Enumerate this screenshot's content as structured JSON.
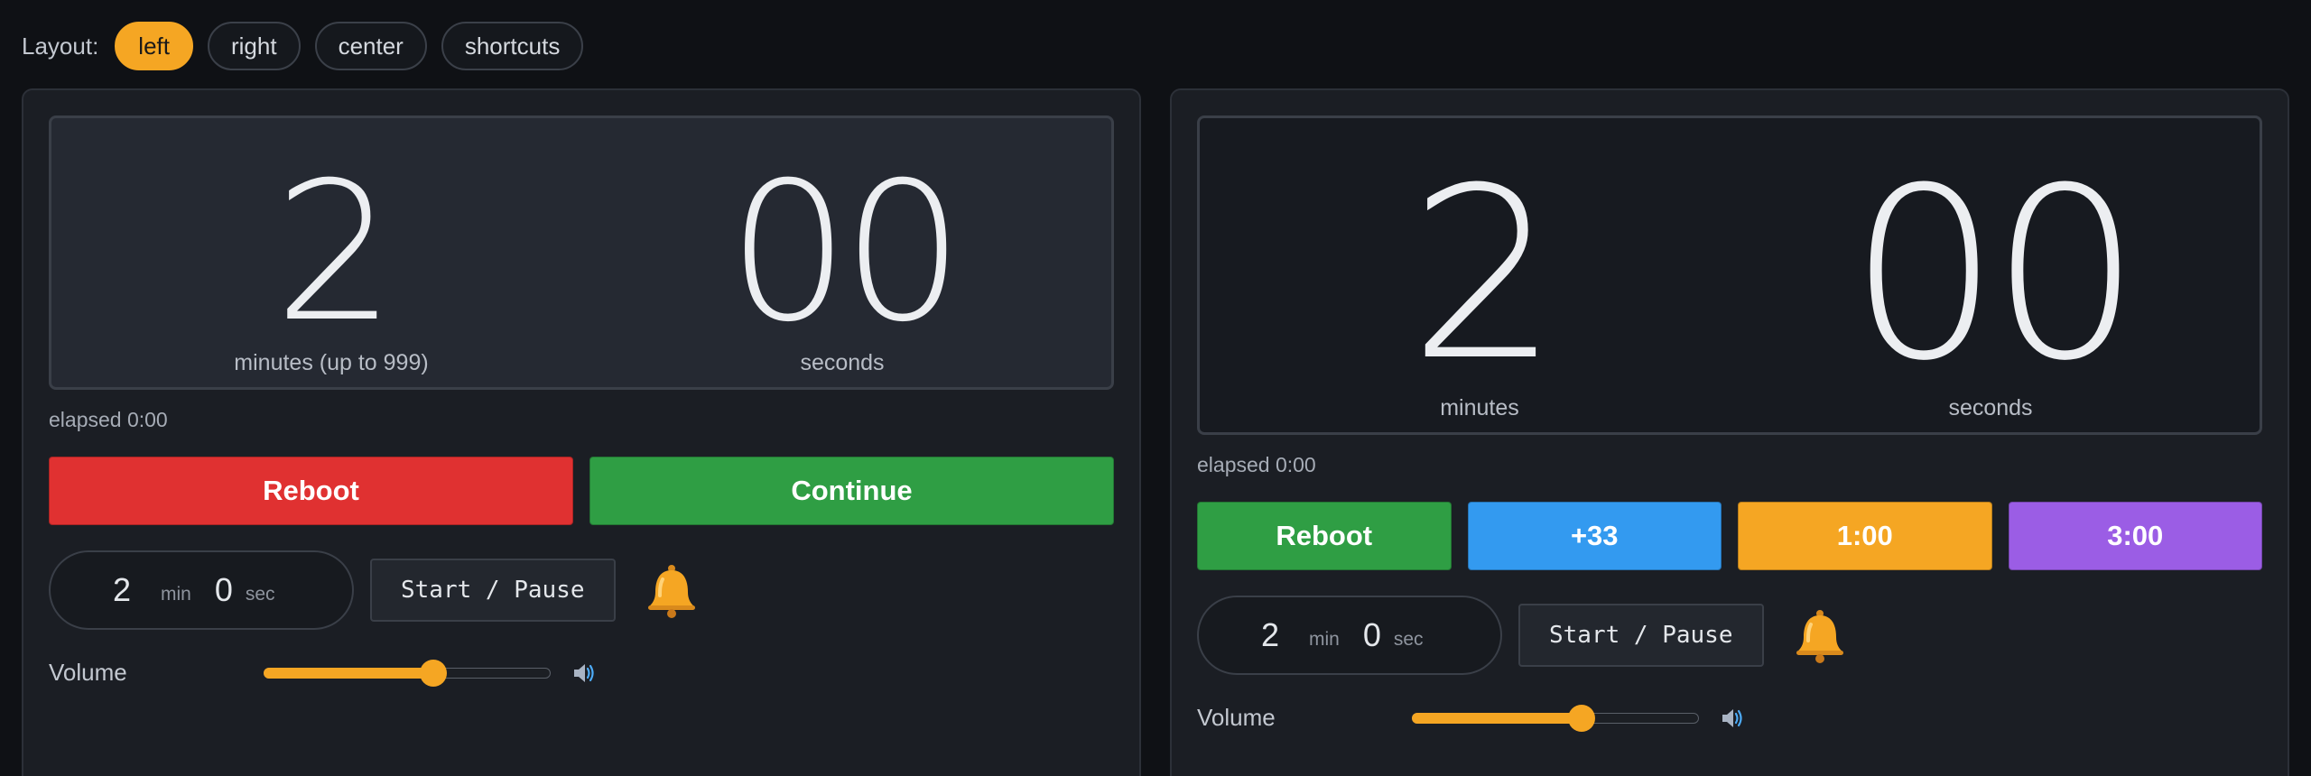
{
  "layout": {
    "label": "Layout:",
    "options": [
      {
        "label": "left",
        "active": true
      },
      {
        "label": "right",
        "active": false
      },
      {
        "label": "center",
        "active": false
      },
      {
        "label": "shortcuts",
        "active": false
      }
    ]
  },
  "colors": {
    "accent": "#f5a623",
    "red": "#e03131",
    "green": "#2f9e44",
    "blue": "#339af0",
    "orange": "#f5a623",
    "purple": "#9b5de5"
  },
  "left_panel": {
    "minutes": "2",
    "minutes_caption": "minutes (up to 999)",
    "seconds": "00",
    "seconds_caption": "seconds",
    "elapsed": "elapsed 0:00",
    "buttons": [
      {
        "label": "Reboot",
        "color": "#e03131"
      },
      {
        "label": "Continue",
        "color": "#2f9e44"
      }
    ],
    "input": {
      "minutes": "2",
      "min_unit": "min",
      "seconds": "0",
      "sec_unit": "sec"
    },
    "start_pause": "Start / Pause",
    "bell_icon": "bell-icon",
    "volume": {
      "label": "Volume",
      "level": 0.59,
      "icon": "speaker-icon"
    }
  },
  "right_panel": {
    "minutes": "2",
    "minutes_caption": "minutes",
    "seconds": "00",
    "seconds_caption": "seconds",
    "elapsed": "elapsed 0:00",
    "buttons": [
      {
        "label": "Reboot",
        "color": "#2f9e44"
      },
      {
        "label": "+33",
        "color": "#339af0"
      },
      {
        "label": "1:00",
        "color": "#f5a623"
      },
      {
        "label": "3:00",
        "color": "#9b5de5"
      }
    ],
    "input": {
      "minutes": "2",
      "min_unit": "min",
      "seconds": "0",
      "sec_unit": "sec"
    },
    "start_pause": "Start / Pause",
    "bell_icon": "bell-icon",
    "volume": {
      "label": "Volume",
      "level": 0.59,
      "icon": "speaker-icon"
    }
  }
}
